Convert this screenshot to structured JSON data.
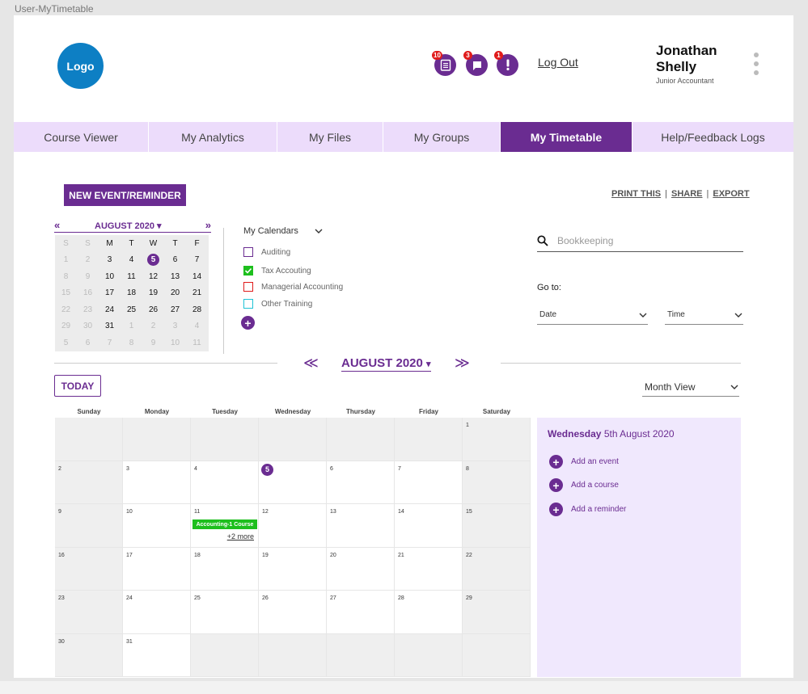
{
  "frame_label": "User-MyTimetable",
  "header": {
    "logo": "Logo",
    "notifications": [
      {
        "icon": "clipboard-icon",
        "badge": "10"
      },
      {
        "icon": "chat-icon",
        "badge": "3"
      },
      {
        "icon": "alert-icon",
        "badge": "1"
      }
    ],
    "logout": "Log Out",
    "user_name": "Jonathan Shelly",
    "user_role": "Junior Accountant"
  },
  "nav": {
    "tabs": [
      "Course Viewer",
      "My Analytics",
      "My Files",
      "My Groups",
      "My Timetable",
      "Help/Feedback Logs"
    ],
    "active": "My Timetable"
  },
  "toolbar": {
    "new_event": "NEW EVENT/REMINDER",
    "print": "PRINT THIS",
    "share": "SHARE",
    "export": "EXPORT",
    "separator": "|"
  },
  "mini_calendar": {
    "prev": "«",
    "next": "»",
    "month": "AUGUST 2020",
    "weekdays": [
      "S",
      "S",
      "M",
      "T",
      "W",
      "T",
      "F"
    ],
    "weeks": [
      [
        "1",
        "2",
        "3",
        "4",
        "5",
        "6",
        "7"
      ],
      [
        "8",
        "9",
        "10",
        "11",
        "12",
        "13",
        "14"
      ],
      [
        "15",
        "16",
        "17",
        "18",
        "19",
        "20",
        "21"
      ],
      [
        "22",
        "23",
        "24",
        "25",
        "26",
        "27",
        "28"
      ],
      [
        "29",
        "30",
        "31",
        "1",
        "2",
        "3",
        "4"
      ],
      [
        "5",
        "6",
        "7",
        "8",
        "9",
        "10",
        "11"
      ]
    ],
    "today": "5"
  },
  "my_calendars": {
    "title": "My Calendars",
    "items": [
      {
        "label": "Auditing",
        "color": "#6a2c91",
        "checked": false
      },
      {
        "label": "Tax Accouting",
        "color": "#1dbf1d",
        "checked": true
      },
      {
        "label": "Managerial Accounting",
        "color": "#e01b1b",
        "checked": false
      },
      {
        "label": "Other Training",
        "color": "#1fc3d6",
        "checked": false
      }
    ]
  },
  "search": {
    "placeholder": "Bookkeeping"
  },
  "goto": {
    "label": "Go to:",
    "date": "Date",
    "time": "Time"
  },
  "month_bar": {
    "prev": "≪",
    "next": "≫",
    "month": "AUGUST 2020"
  },
  "today_button": "TODAY",
  "view_select": "Month View",
  "calendar": {
    "weekdays": [
      "Sunday",
      "Monday",
      "Tuesday",
      "Wednesday",
      "Thursday",
      "Friday",
      "Saturday"
    ],
    "weeks": [
      [
        "",
        "",
        "",
        "",
        "",
        "",
        "1"
      ],
      [
        "2",
        "3",
        "4",
        "5",
        "6",
        "7",
        "8"
      ],
      [
        "9",
        "10",
        "11",
        "12",
        "13",
        "14",
        "15"
      ],
      [
        "16",
        "17",
        "18",
        "19",
        "20",
        "21",
        "22"
      ],
      [
        "23",
        "24",
        "25",
        "26",
        "27",
        "28",
        "29"
      ],
      [
        "30",
        "31",
        "",
        "",
        "",
        "",
        ""
      ]
    ],
    "today": "5",
    "events": [
      {
        "day": "11",
        "title": "Accounting-1 Course",
        "more": "+2 more"
      }
    ]
  },
  "day_panel": {
    "weekday": "Wednesday",
    "date": "5th August 2020",
    "actions": [
      "Add an event",
      "Add a course",
      "Add a reminder"
    ]
  },
  "colors": {
    "accent": "#6a2c91",
    "nav_bg": "#ecdcfb",
    "panel_bg": "#f0e8fd",
    "logo": "#0d7fc4",
    "badge": "#e01b1b",
    "event": "#1dbf1d"
  }
}
